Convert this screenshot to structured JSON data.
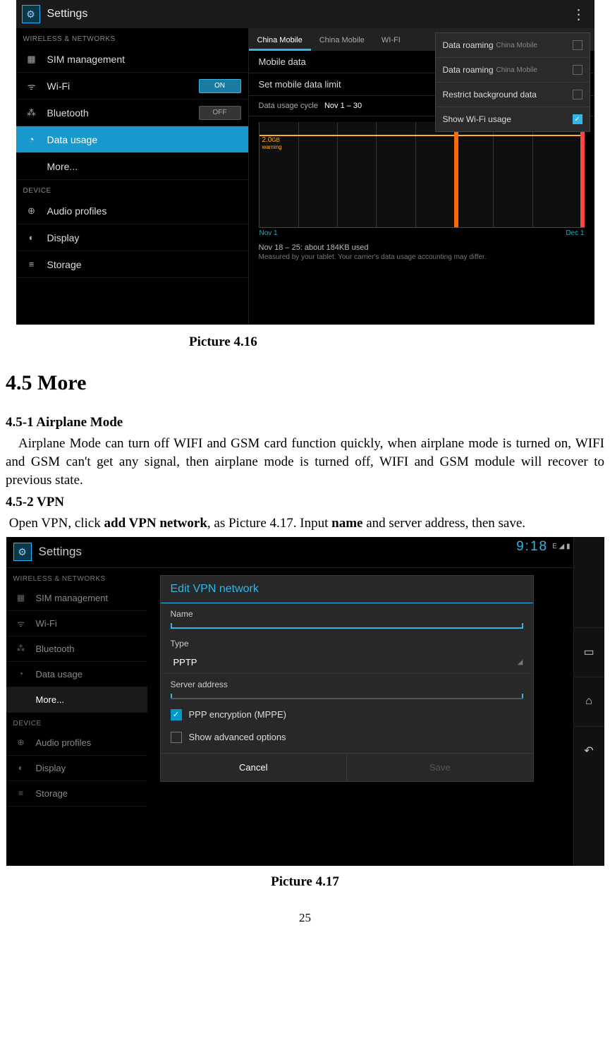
{
  "shot1": {
    "topbar": {
      "title": "Settings",
      "menu_icon": "⋮"
    },
    "sidebar": {
      "cat1": "WIRELESS & NETWORKS",
      "items1": [
        {
          "icon": "▦",
          "label": "SIM management"
        },
        {
          "icon": "ᯤ",
          "label": "Wi-Fi",
          "toggle": "ON",
          "toggle_state": "on"
        },
        {
          "icon": "⁂",
          "label": "Bluetooth",
          "toggle": "OFF",
          "toggle_state": "off"
        },
        {
          "icon": "◔",
          "label": "Data usage",
          "selected": true
        },
        {
          "icon": "",
          "label": "More..."
        }
      ],
      "cat2": "DEVICE",
      "items2": [
        {
          "icon": "⊕",
          "label": "Audio profiles"
        },
        {
          "icon": "◐",
          "label": "Display"
        },
        {
          "icon": "≡",
          "label": "Storage"
        }
      ]
    },
    "main": {
      "tabs": [
        {
          "label": "China Mobile",
          "active": true
        },
        {
          "label": "China Mobile",
          "active": false
        },
        {
          "label": "WI-FI",
          "active": false
        }
      ],
      "rows": {
        "mobile_data": "Mobile data",
        "set_limit": "Set mobile data limit",
        "cycle_label": "Data usage cycle",
        "cycle_value": "Nov 1 – 30"
      },
      "graph": {
        "threshold_value": "2.0",
        "threshold_unit": "GB",
        "threshold_sub": "warning",
        "x_start": "Nov 1",
        "x_end": "Dec 1"
      },
      "summary": "Nov 18 – 25: about 184KB used",
      "summary_note": "Measured by your tablet. Your carrier's data usage accounting may differ."
    },
    "popover": {
      "items": [
        {
          "label": "Data roaming",
          "sub": "China Mobile",
          "checked": false
        },
        {
          "label": "Data roaming",
          "sub": "China Mobile",
          "checked": false
        },
        {
          "label": "Restrict background data",
          "checked": false
        },
        {
          "label": "Show Wi-Fi usage",
          "checked": true
        }
      ]
    }
  },
  "doc": {
    "caption1": "Picture 4.16",
    "section_heading": "4.5 More",
    "sub1": "4.5-1 Airplane Mode",
    "para1": "Airplane Mode can turn off WIFI and GSM card function quickly, when airplane mode is turned on, WIFI and GSM can't get any signal, then airplane mode is turned off, WIFI and GSM module will recover to previous state.",
    "sub2": "4.5-2 VPN",
    "para2_pre": "Open VPN, click ",
    "para2_bold1": "add VPN network",
    "para2_mid": ", as Picture 4.17. Input ",
    "para2_bold2": "name",
    "para2_post": " and server address, then save.",
    "caption2": "Picture 4.17",
    "page_number": "25"
  },
  "shot2": {
    "status": {
      "time": "9:18",
      "icons": "E ◢ ▮"
    },
    "topbar": {
      "title": "Settings"
    },
    "sidebar": {
      "cat1": "WIRELESS & NETWORKS",
      "items1": [
        {
          "icon": "▦",
          "label": "SIM management"
        },
        {
          "icon": "ᯤ",
          "label": "Wi-Fi"
        },
        {
          "icon": "⁂",
          "label": "Bluetooth"
        },
        {
          "icon": "◔",
          "label": "Data usage"
        },
        {
          "icon": "",
          "label": "More...",
          "selected": true
        }
      ],
      "cat2": "DEVICE",
      "items2": [
        {
          "icon": "⊕",
          "label": "Audio profiles"
        },
        {
          "icon": "◐",
          "label": "Display"
        },
        {
          "icon": "≡",
          "label": "Storage"
        }
      ]
    },
    "dialog": {
      "title": "Edit VPN network",
      "name_label": "Name",
      "type_label": "Type",
      "type_value": "PPTP",
      "server_label": "Server address",
      "ppp_label": "PPP encryption (MPPE)",
      "advanced_label": "Show advanced options",
      "cancel": "Cancel",
      "save": "Save"
    },
    "nav": {
      "recent": "▭",
      "home": "⌂",
      "back": "↶"
    }
  }
}
